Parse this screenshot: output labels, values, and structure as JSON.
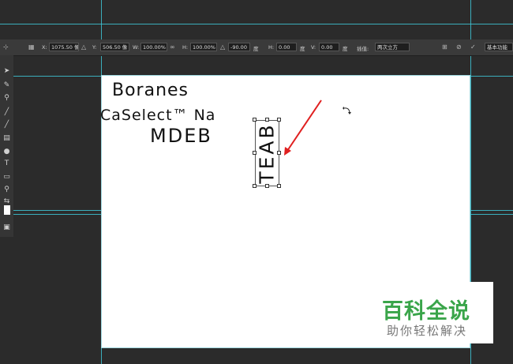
{
  "options_bar": {
    "x_label": "X:",
    "x_value": "1075.50 像",
    "y_label": "Y:",
    "y_value": "506.50 像",
    "w_label": "W:",
    "w_value": "100.00%",
    "h_label": "H:",
    "h_value": "100.00%",
    "angle_value": "-90.00",
    "angle_unit": "度",
    "hskew_label": "H:",
    "hskew_value": "0.00",
    "hskew_unit": "度",
    "vskew_label": "V:",
    "vskew_value": "0.00",
    "vskew_unit": "度",
    "interp_label": "插值:",
    "interp_value": "两次立方",
    "workspace": "基本功能"
  },
  "canvas": {
    "texts": {
      "boranes": "Boranes",
      "caselect": "CaSelect™ Na",
      "mdeb": "MDEB",
      "teab": "TEAB"
    },
    "annotation_color": "#e02020"
  },
  "watermark": {
    "brand": "百科全说",
    "slogan": "助你轻松解决",
    "brand_color": "#3aa54a"
  }
}
